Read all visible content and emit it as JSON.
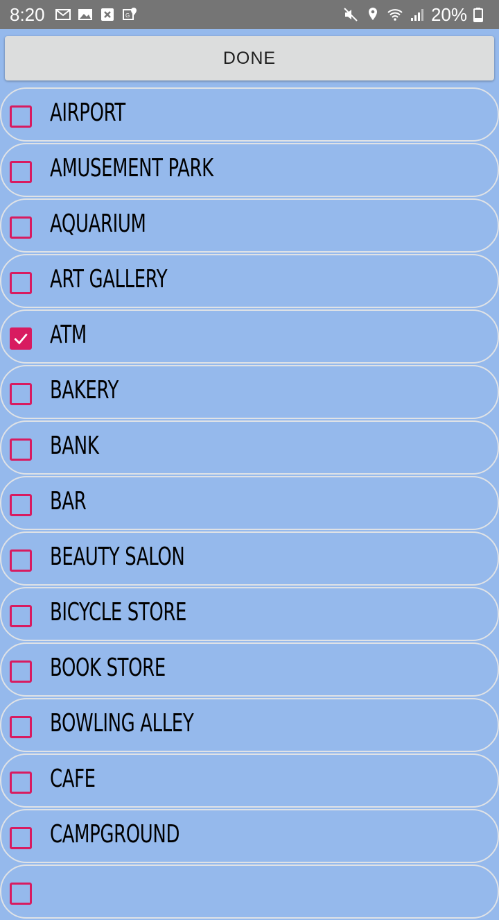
{
  "status_bar": {
    "time": "8:20",
    "battery": "20%",
    "left_icons": [
      "gmail-icon",
      "image-icon",
      "close-box-icon",
      "maps-icon"
    ],
    "right_icons": [
      "mute-icon",
      "location-icon",
      "wifi-icon",
      "signal-icon",
      "battery-icon"
    ]
  },
  "done_label": "DONE",
  "colors": {
    "background": "#95b9ec",
    "checkbox_accent": "#d81b60",
    "status_bar": "#757575",
    "button": "#dcdddd"
  },
  "items": [
    {
      "label": "AIRPORT",
      "checked": false
    },
    {
      "label": "AMUSEMENT PARK",
      "checked": false
    },
    {
      "label": "AQUARIUM",
      "checked": false
    },
    {
      "label": "ART GALLERY",
      "checked": false
    },
    {
      "label": "ATM",
      "checked": true
    },
    {
      "label": "BAKERY",
      "checked": false
    },
    {
      "label": "BANK",
      "checked": false
    },
    {
      "label": "BAR",
      "checked": false
    },
    {
      "label": "BEAUTY SALON",
      "checked": false
    },
    {
      "label": "BICYCLE STORE",
      "checked": false
    },
    {
      "label": "BOOK STORE",
      "checked": false
    },
    {
      "label": "BOWLING ALLEY",
      "checked": false
    },
    {
      "label": "CAFE",
      "checked": false
    },
    {
      "label": "CAMPGROUND",
      "checked": false
    },
    {
      "label": "",
      "checked": false
    }
  ]
}
